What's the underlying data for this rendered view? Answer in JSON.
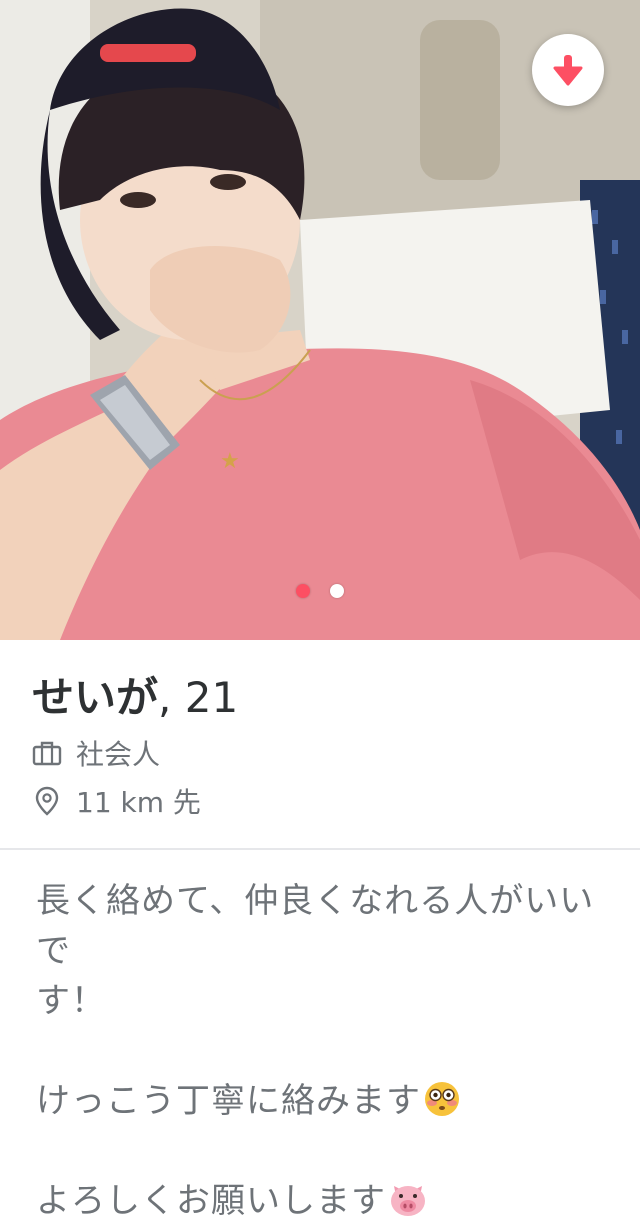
{
  "profile": {
    "name": "せいが",
    "age_text": ", 21",
    "job": "社会人",
    "distance": "11 km 先",
    "bio": {
      "line1": "長く絡めて、仲良くなれる人がいいで",
      "line2": "す！",
      "line3": "けっこう丁寧に絡みます",
      "line4": "よろしくお願いします"
    }
  },
  "photo": {
    "count": 2,
    "active_index": 0
  },
  "colors": {
    "accent": "#fd4f63",
    "text_dark": "#2e3133",
    "text_muted": "#6e7378",
    "divider": "#e6e7ea"
  },
  "icons": {
    "collapse": "arrow-down-icon",
    "job": "briefcase-icon",
    "distance": "location-pin-icon",
    "emoji1": "flushed-face-emoji",
    "emoji2": "pig-face-emoji"
  }
}
